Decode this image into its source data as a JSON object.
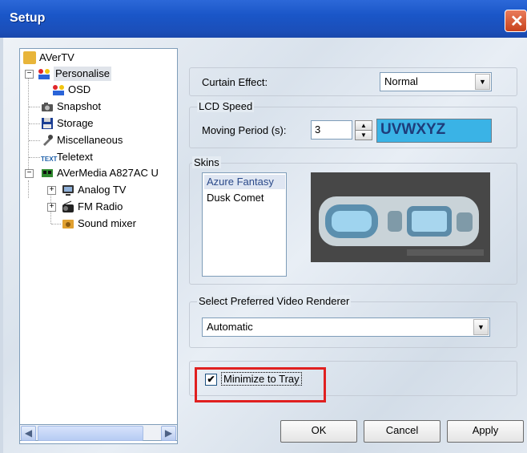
{
  "window": {
    "title": "Setup"
  },
  "tree": {
    "items": [
      {
        "label": "AVerTV"
      },
      {
        "label": "Personalise"
      },
      {
        "label": "OSD"
      },
      {
        "label": "Snapshot"
      },
      {
        "label": "Storage"
      },
      {
        "label": "Miscellaneous"
      },
      {
        "label": "Teletext"
      },
      {
        "label": "AVerMedia A827AC U"
      },
      {
        "label": "Analog TV"
      },
      {
        "label": "FM Radio"
      },
      {
        "label": "Sound mixer"
      }
    ],
    "expander_minus": "−",
    "expander_plus": "+",
    "teletext_icon_text": "TEXT"
  },
  "curtain": {
    "label": "Curtain Effect:",
    "value": "Normal"
  },
  "lcd": {
    "group_label": "LCD Speed",
    "moving_label": "Moving Period (s):",
    "value": "3",
    "preview_text": "UVWXYZ"
  },
  "skins": {
    "group_label": "Skins",
    "items": [
      "Azure Fantasy",
      "Dusk Comet"
    ]
  },
  "renderer": {
    "group_label": "Select Preferred Video Renderer",
    "value": "Automatic"
  },
  "tray": {
    "label": "Minimize to Tray",
    "checked": true
  },
  "buttons": {
    "ok": "OK",
    "cancel": "Cancel",
    "apply": "Apply"
  },
  "colors": {
    "title_blue": "#1a56c8",
    "highlight_red": "#e02020",
    "lcd_bg": "#3ab3e6"
  }
}
